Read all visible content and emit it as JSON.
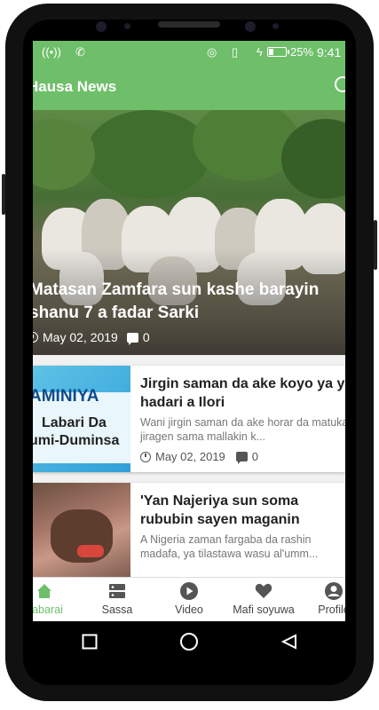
{
  "status_bar": {
    "left_icons": [
      "hotspot-icon",
      "missed-call-icon"
    ],
    "right_icons": [
      "wifi-icon",
      "vibrate-icon",
      "charging-icon"
    ],
    "battery_percent": "25%",
    "battery_level": 0.25,
    "time": "9:41"
  },
  "app_bar": {
    "title": "Hausa News",
    "search_icon": "search-icon"
  },
  "hero": {
    "title": "Matasan Zamfara sun kashe barayin shanu 7 a fadar Sarki",
    "date": "May 02, 2019",
    "comments": "0"
  },
  "articles": [
    {
      "title": "Jirgin saman da ake koyo ya yi hadari a Ilori",
      "summary": "Wani jirgin saman da ake horar da matuka jiragen sama mallakin k...",
      "date": "May 02, 2019",
      "comments": "0",
      "thumb_text_1": "AMINIYA",
      "thumb_text_2": "Labari Da",
      "thumb_text_3": "umi-Duminsa"
    },
    {
      "title": "'Yan Najeriya sun soma rububin sayen maganin",
      "summary": "A Nigeria zaman fargaba da rashin madafa, ya tilastawa wasu al'umm..."
    }
  ],
  "bottom_nav": [
    {
      "label": "Labarai",
      "icon": "home-icon",
      "active": true
    },
    {
      "label": "Sassa",
      "icon": "categories-icon",
      "active": false
    },
    {
      "label": "Video",
      "icon": "play-icon",
      "active": false
    },
    {
      "label": "Mafi soyuwa",
      "icon": "heart-icon",
      "active": false
    },
    {
      "label": "Profile",
      "icon": "profile-icon",
      "active": false
    }
  ],
  "colors": {
    "accent": "#6fbf6a",
    "text_dark": "#222222",
    "text_muted": "#777777"
  }
}
